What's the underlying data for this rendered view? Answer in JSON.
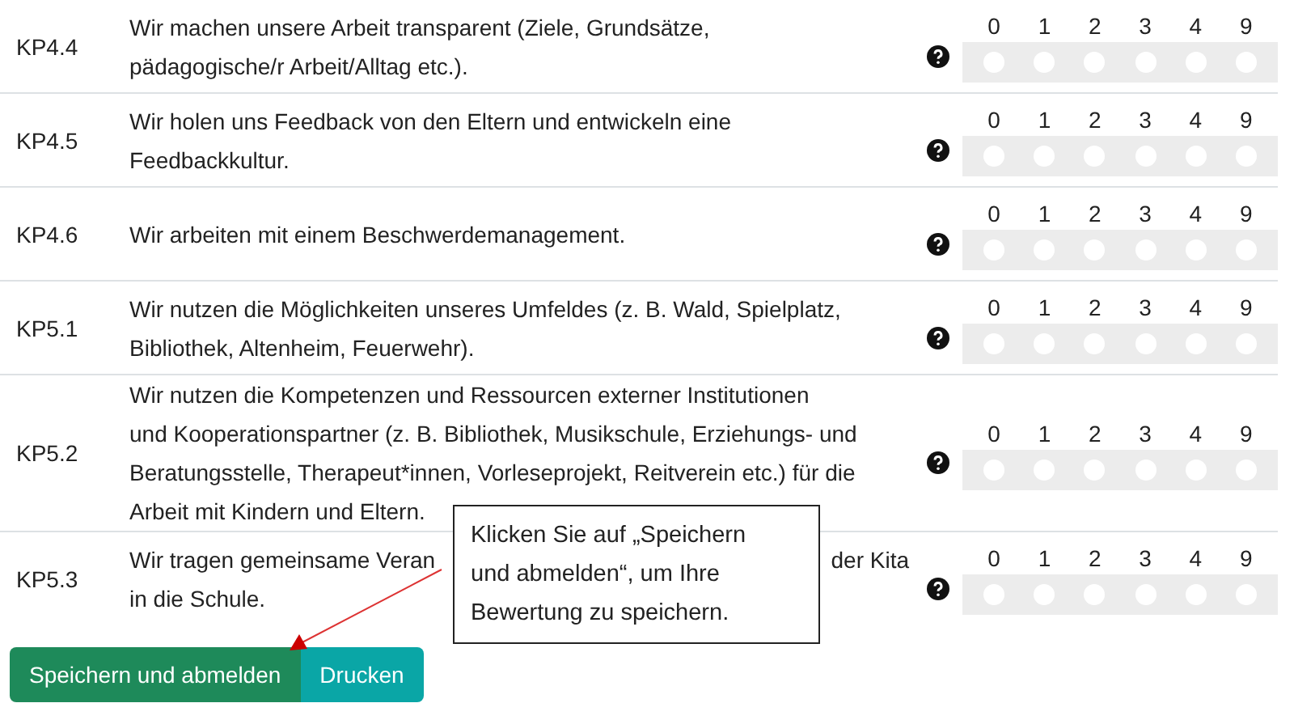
{
  "rows": [
    {
      "code": "KP4.4",
      "lines": [
        [
          "Wir machen unsere Arbeit transparent (Ziele, Grundsätze,"
        ],
        [
          "pädagogische/r Arbeit/Alltag etc.)."
        ]
      ],
      "options": [
        {
          "label": "0",
          "selected": false
        },
        {
          "label": "1",
          "selected": false
        },
        {
          "label": "2",
          "selected": false
        },
        {
          "label": "3",
          "selected": false
        },
        {
          "label": "4",
          "selected": false
        },
        {
          "label": "9",
          "selected": false
        }
      ]
    },
    {
      "code": "KP4.5",
      "lines": [
        [
          "Wir holen uns Feedback von den Eltern und entwickeln eine"
        ],
        [
          "Feedbackkultur."
        ]
      ],
      "options": [
        {
          "label": "0",
          "selected": false
        },
        {
          "label": "1",
          "selected": false
        },
        {
          "label": "2",
          "selected": false
        },
        {
          "label": "3",
          "selected": false
        },
        {
          "label": "4",
          "selected": false
        },
        {
          "label": "9",
          "selected": false
        }
      ]
    },
    {
      "code": "KP4.6",
      "lines": [
        [
          "Wir arbeiten mit einem Beschwerdemanagement."
        ]
      ],
      "options": [
        {
          "label": "0",
          "selected": false
        },
        {
          "label": "1",
          "selected": false
        },
        {
          "label": "2",
          "selected": false
        },
        {
          "label": "3",
          "selected": false
        },
        {
          "label": "4",
          "selected": false
        },
        {
          "label": "9",
          "selected": false
        }
      ]
    },
    {
      "code": "KP5.1",
      "lines": [
        [
          "Wir nutzen die Möglichkeiten unseres Umfeldes (z. B. Wald, Spielplatz,"
        ],
        [
          "Bibliothek, Altenheim, Feuerwehr)."
        ]
      ],
      "options": [
        {
          "label": "0",
          "selected": false
        },
        {
          "label": "1",
          "selected": false
        },
        {
          "label": "2",
          "selected": false
        },
        {
          "label": "3",
          "selected": false
        },
        {
          "label": "4",
          "selected": false
        },
        {
          "label": "9",
          "selected": false
        }
      ]
    },
    {
      "code": "KP5.2",
      "lines": [
        [
          "Wir nutzen die Kompetenzen und Ressourcen externer Institutionen"
        ],
        [
          "und Kooperationspartner (z. B. Bibliothek, Musikschule, Erziehungs- und"
        ],
        [
          "Beratungsstelle, Therapeut*innen, Vorleseprojekt, Reitverein etc.) für die"
        ],
        [
          "Arbeit mit Kindern und Eltern."
        ]
      ],
      "options": [
        {
          "label": "0",
          "selected": false
        },
        {
          "label": "1",
          "selected": false
        },
        {
          "label": "2",
          "selected": false
        },
        {
          "label": "3",
          "selected": false
        },
        {
          "label": "4",
          "selected": false
        },
        {
          "label": "9",
          "selected": false
        }
      ]
    },
    {
      "code": "KP5.3",
      "lines": [
        [
          "Wir tragen gemeinsame Veran",
          "der Kita"
        ],
        [
          "in die Schule."
        ]
      ],
      "options": [
        {
          "label": "0",
          "selected": false
        },
        {
          "label": "1",
          "selected": false
        },
        {
          "label": "2",
          "selected": false
        },
        {
          "label": "3",
          "selected": false
        },
        {
          "label": "4",
          "selected": false
        },
        {
          "label": "9",
          "selected": false
        }
      ]
    }
  ],
  "buttons": [
    {
      "label": "Speichern und abmelden",
      "kind": "primary"
    },
    {
      "label": "Drucken",
      "kind": "secondary"
    }
  ],
  "callout": {
    "lines": [
      "Klicken Sie auf „Speichern",
      "und abmelden“, um Ihre",
      "Bewertung zu speichern."
    ]
  }
}
